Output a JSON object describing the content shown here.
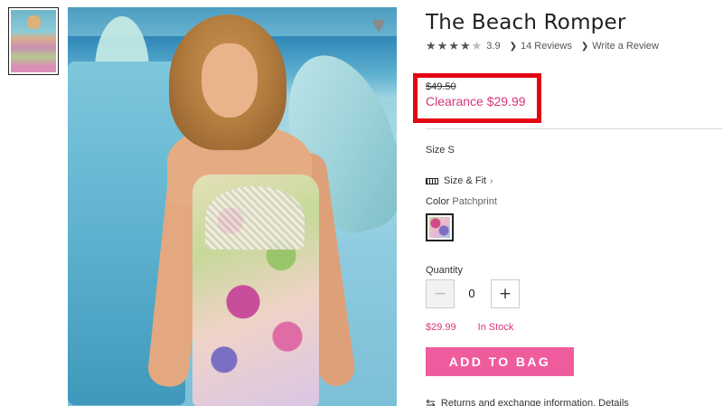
{
  "product": {
    "title": "The Beach Romper",
    "rating": "3.9",
    "rating_stars": 3.9,
    "reviews_link": "14 Reviews",
    "write_review_link": "Write a Review"
  },
  "price": {
    "original": "$49.50",
    "clearance": "Clearance $29.99",
    "highlight_color": "#e30613"
  },
  "options": {
    "size_label": "Size",
    "size_value": "S",
    "size_fit_link": "Size & Fit",
    "color_label": "Color",
    "color_value": "Patchprint"
  },
  "quantity": {
    "label": "Quantity",
    "value": "0",
    "minus": "−",
    "plus": "+"
  },
  "stock": {
    "price": "$29.99",
    "status": "In Stock",
    "accent_color": "#d6357c"
  },
  "actions": {
    "add_to_bag": "ADD TO BAG",
    "button_color": "#ef5c9e"
  },
  "returns": {
    "text": "Returns and exchange information. Details"
  },
  "icons": {
    "wishlist": "heart-icon",
    "ruler": "ruler-icon",
    "returns": "returns-icon"
  }
}
